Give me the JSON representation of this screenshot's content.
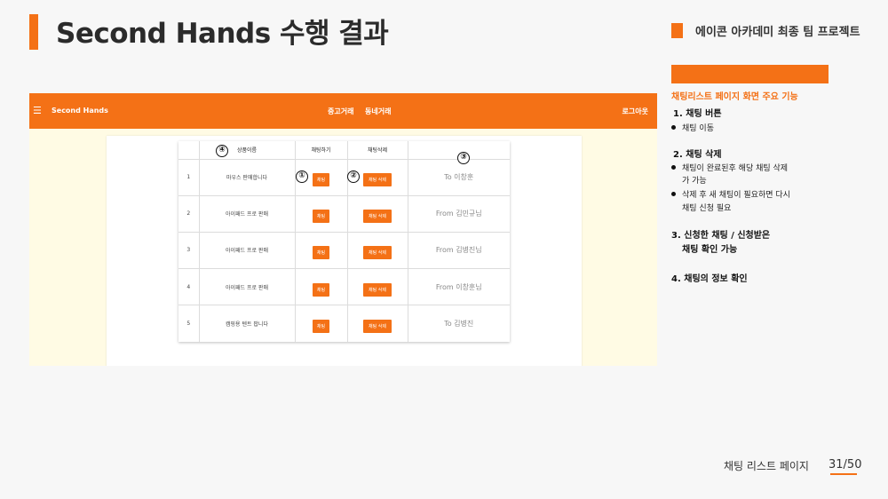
{
  "slide": {
    "title": "Second Hands 수행 결과",
    "project_label": "에이콘 아카데미 최종 팀 프로젝트",
    "footer_label": "채팅 리스트 페이지",
    "page_number": "31/50"
  },
  "app": {
    "menu_icon": "☰",
    "brand": "Second Hands",
    "nav_links": [
      "중고거래",
      "동네거래"
    ],
    "logout": "로그아웃",
    "table": {
      "headers": [
        "",
        "상품이름",
        "채팅하기",
        "채팅삭제",
        ""
      ],
      "rows": [
        {
          "no": "1",
          "product": "마우스 판매합니다",
          "chat_btn": "채팅",
          "delete_btn": "채팅 삭제",
          "partner": "To 이창훈"
        },
        {
          "no": "2",
          "product": "아이패드 프로 판매",
          "chat_btn": "채팅",
          "delete_btn": "채팅 삭제",
          "partner": "From 김민규님"
        },
        {
          "no": "3",
          "product": "아이패드 프로 판매",
          "chat_btn": "채팅",
          "delete_btn": "채팅 삭제",
          "partner": "From 김병진님"
        },
        {
          "no": "4",
          "product": "아이패드 프로 판매",
          "chat_btn": "채팅",
          "delete_btn": "채팅 삭제",
          "partner": "From 이창훈님"
        },
        {
          "no": "5",
          "product": "캠핑용 텐트 팝니다",
          "chat_btn": "채팅",
          "delete_btn": "채팅 삭제",
          "partner": "To 김병진"
        }
      ]
    },
    "markers": [
      "④",
      "①",
      "②",
      "③"
    ]
  },
  "features": {
    "heading": "채팅리스트 페이지 화면 주요 기능",
    "s1_title": "1. 채팅 버튼",
    "s1_b1": "채팅 이동",
    "s2_title": "2. 채팅 삭제",
    "s2_b1": "채팅이 완료된후 해당 채팅 삭제",
    "s2_b1_cont": "가 가능",
    "s2_b2": "삭제 후 새 채팅이 필요하면  다시",
    "s2_b2_cont": "채팅 신청 필요",
    "s3_title": "3. 신청한 채팅 / 신청받은",
    "s3_title_cont": "채팅 확인 가능",
    "s4_title": "4. 채팅의 정보 확인"
  },
  "colors": {
    "accent": "#f47116",
    "app_background": "#fffbe4"
  }
}
